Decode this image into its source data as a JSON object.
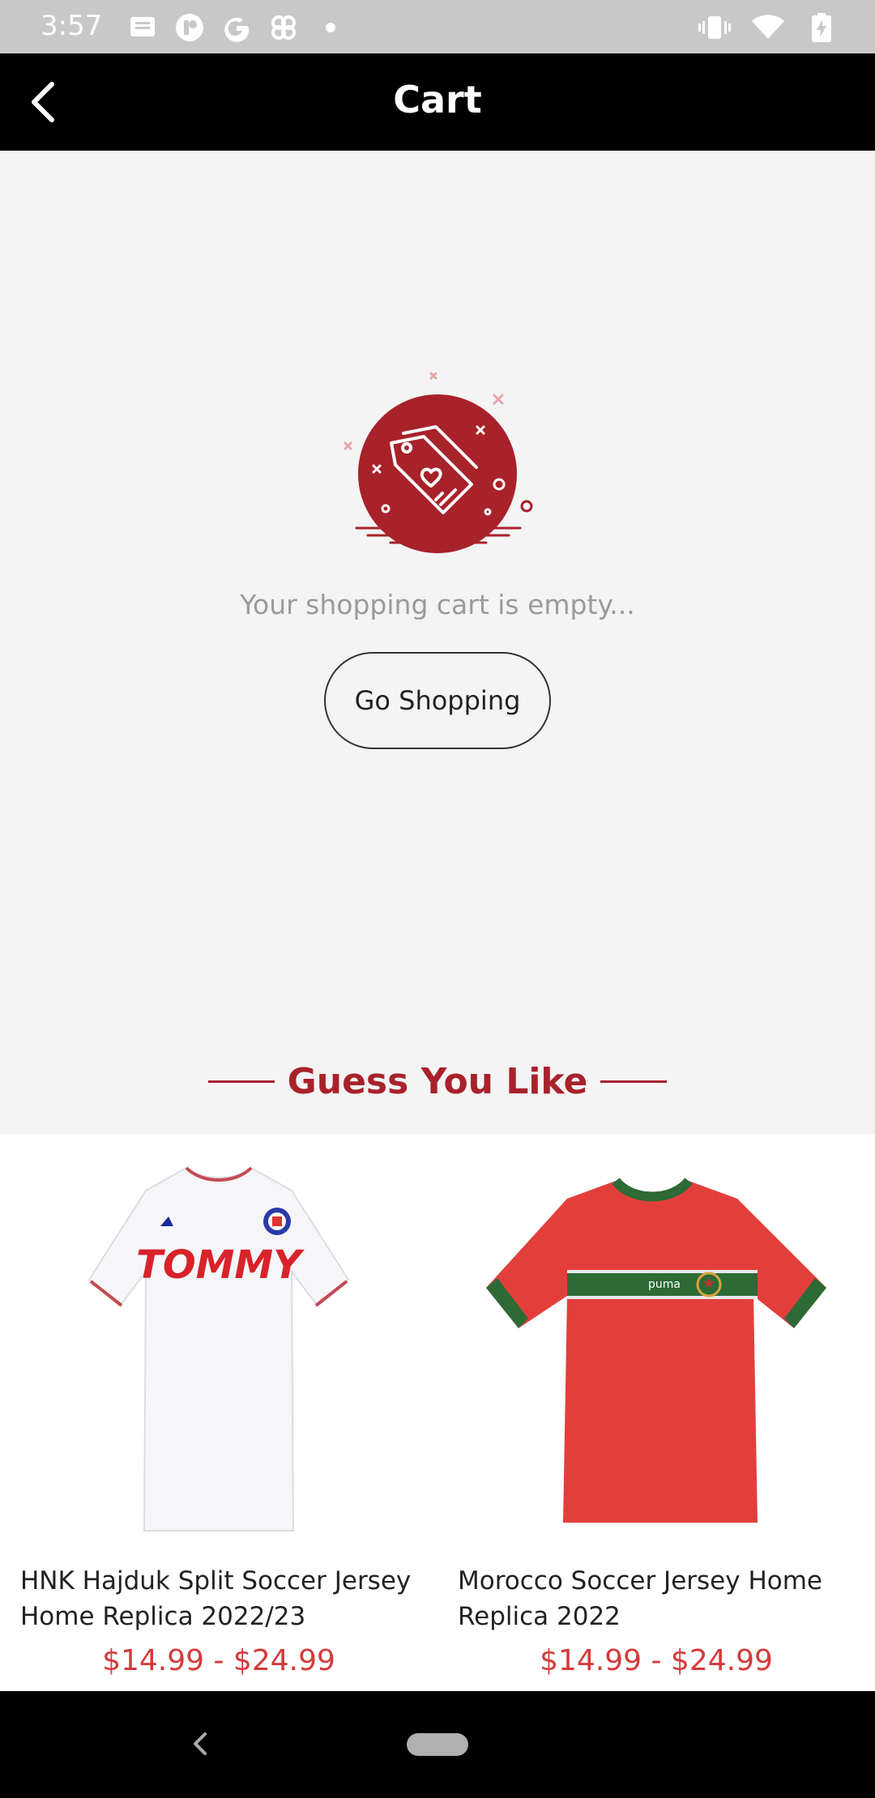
{
  "status_bar": {
    "time": "3:57",
    "left_icons": [
      "message-icon",
      "app-icon",
      "google-icon",
      "pinwheel-icon",
      "dot-icon"
    ],
    "right_icons": [
      "vibrate-icon",
      "wifi-icon",
      "battery-charging-icon"
    ]
  },
  "header": {
    "title": "Cart",
    "back_icon": "chevron-left-icon"
  },
  "empty_cart": {
    "message": "Your shopping cart is empty...",
    "button_label": "Go Shopping",
    "illustration_icon": "price-tag-heart-icon"
  },
  "recommendations": {
    "title": "Guess You Like",
    "products": [
      {
        "name": "HNK Hajduk Split Soccer Jersey Home Replica 2022/23",
        "price": "$14.99 - $24.99",
        "image_text": "TOMMY",
        "jersey_color": "#f6f6f8"
      },
      {
        "name": "Morocco Soccer Jersey Home Replica 2022",
        "price": "$14.99 - $24.99",
        "jersey_color": "#e23f3c"
      }
    ]
  },
  "colors": {
    "accent": "#a8222a",
    "price": "#d63a3a",
    "header_bg": "#000000",
    "page_bg": "#f4f4f4"
  }
}
